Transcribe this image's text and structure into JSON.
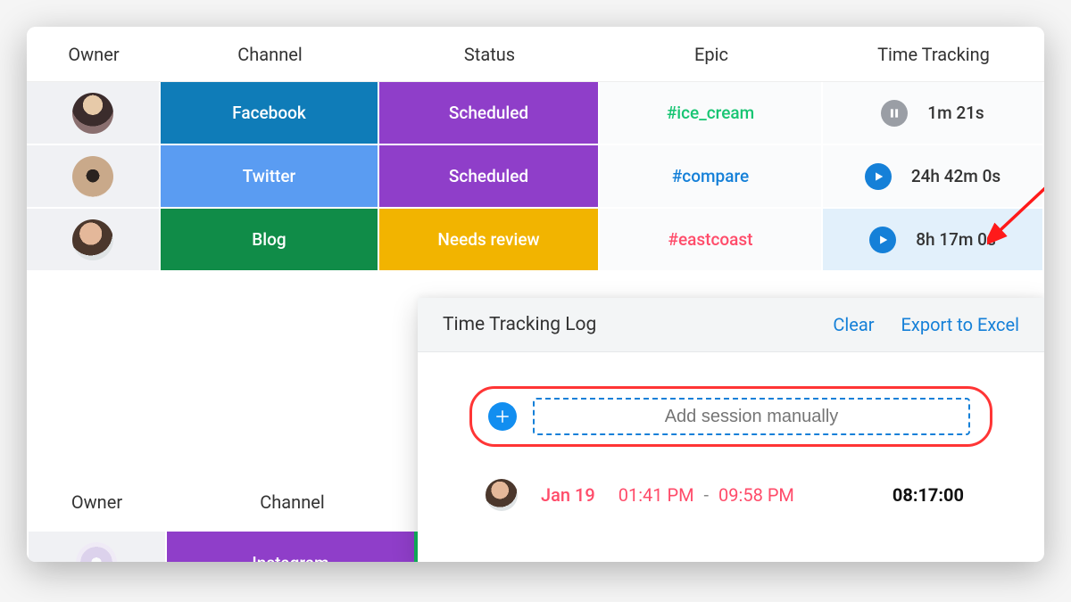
{
  "table1": {
    "headers": {
      "owner": "Owner",
      "channel": "Channel",
      "status": "Status",
      "epic": "Epic",
      "time": "Time Tracking"
    },
    "rows": [
      {
        "channel": "Facebook",
        "status": "Scheduled",
        "epic": "#ice_cream",
        "time": "1m 21s",
        "timer": "paused"
      },
      {
        "channel": "Twitter",
        "status": "Scheduled",
        "epic": "#compare",
        "time": "24h 42m 0s",
        "timer": "play"
      },
      {
        "channel": "Blog",
        "status": "Needs review",
        "epic": "#eastcoast",
        "time": "8h 17m 0s",
        "timer": "play",
        "highlighted": true
      }
    ]
  },
  "table2": {
    "headers": {
      "owner": "Owner",
      "channel": "Channel"
    },
    "row": {
      "channel": "Instagram"
    }
  },
  "panel": {
    "title": "Time Tracking Log",
    "clear": "Clear",
    "export": "Export to Excel",
    "add_placeholder": "Add session manually",
    "entry": {
      "date": "Jan 19",
      "start": "01:41 PM",
      "end": "09:58 PM",
      "duration": "08:17:00"
    }
  }
}
